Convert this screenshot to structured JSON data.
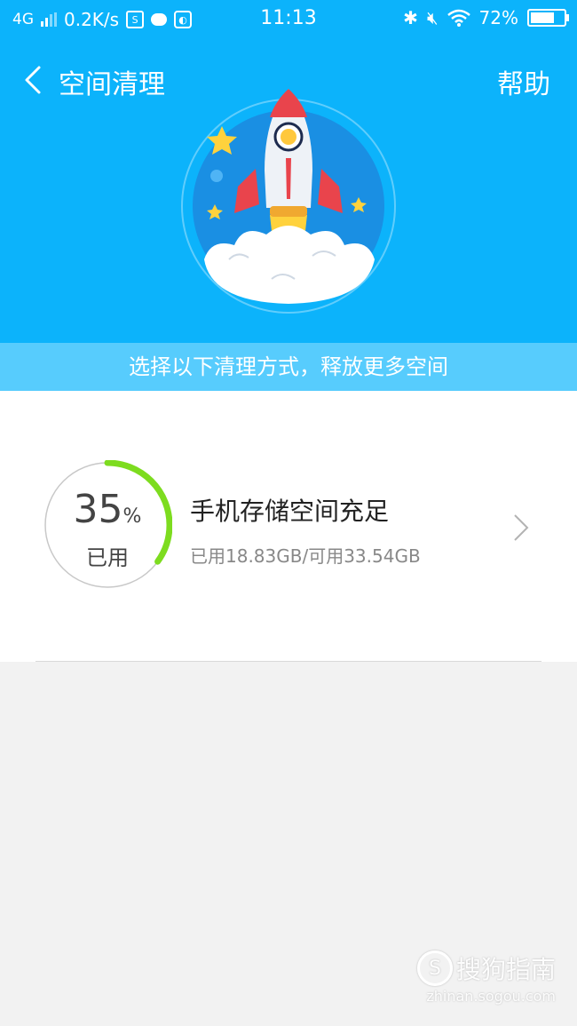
{
  "status_bar": {
    "network": "4G",
    "speed": "0.2K/s",
    "app_badge": "S",
    "time": "11:13",
    "battery": "72%",
    "battery_level": 0.72
  },
  "nav": {
    "title": "空间清理",
    "help": "帮助"
  },
  "banner": {
    "subtitle": "选择以下清理方式，释放更多空间"
  },
  "storage": {
    "percent": "35",
    "percent_symbol": "%",
    "percent_value": 35,
    "used_label": "已用",
    "title": "手机存储空间充足",
    "detail": "已用18.83GB/可用33.54GB"
  },
  "watermark": {
    "logo": "S",
    "brand": "搜狗指南",
    "url": "zhinan.sogou.com"
  },
  "colors": {
    "header_bg": "#0cb3fb",
    "subtitle_bg": "#57ccfd",
    "gauge_fill": "#7ddc1f",
    "gauge_track": "#c8c8c8"
  }
}
